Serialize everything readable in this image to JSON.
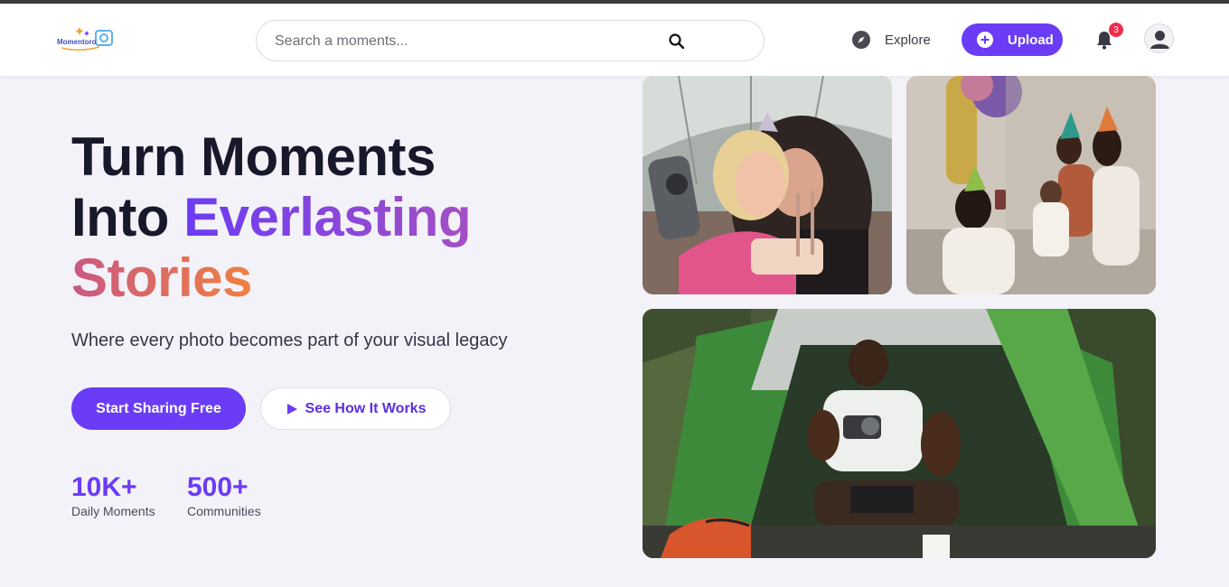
{
  "brand": {
    "logo_text": "Momentoro"
  },
  "search": {
    "placeholder": "Search a moments..."
  },
  "nav": {
    "explore_label": "Explore",
    "upload_label": "Upload",
    "notification_count": "3"
  },
  "hero": {
    "title_line1": "Turn Moments",
    "title_line2_plain": "Into ",
    "title_line2_accent": "Everlasting",
    "title_line3_accent": "Stories",
    "subtitle": "Where every photo becomes part of your visual legacy",
    "primary_cta": "Start Sharing Free",
    "secondary_cta": "See How It Works"
  },
  "stats": [
    {
      "value": "10K+",
      "label": "Daily Moments"
    },
    {
      "value": "500+",
      "label": "Communities"
    }
  ],
  "colors": {
    "accent": "#6b3cf5",
    "badge": "#ef2d4d",
    "gradient_start": "#6b3cf5",
    "gradient_mid": "#a44fc3",
    "gradient_end": "#f08040"
  },
  "icons": {
    "search": "search-icon",
    "explore": "compass-icon",
    "upload": "plus-circle-icon",
    "notifications": "bell-icon",
    "profile": "user-icon",
    "play": "play-icon"
  }
}
